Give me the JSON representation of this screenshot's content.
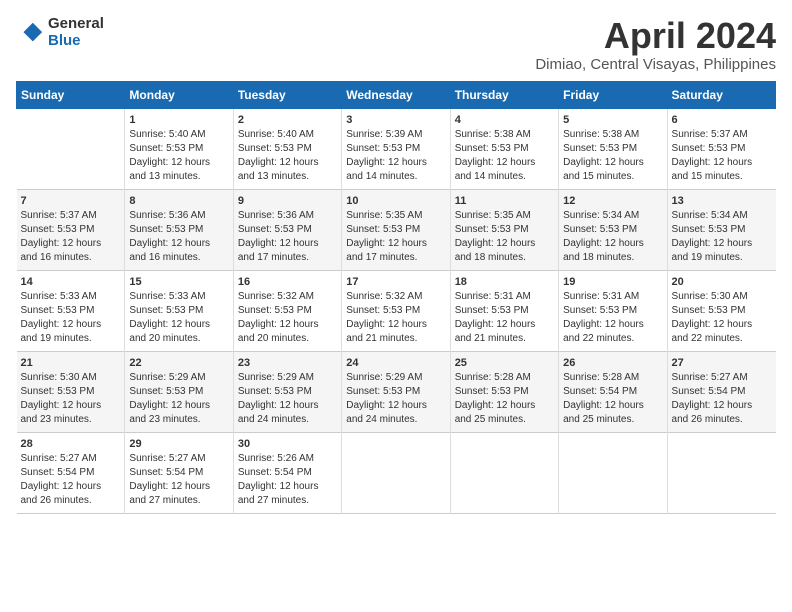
{
  "logo": {
    "general": "General",
    "blue": "Blue"
  },
  "title": "April 2024",
  "subtitle": "Dimiao, Central Visayas, Philippines",
  "days_header": [
    "Sunday",
    "Monday",
    "Tuesday",
    "Wednesday",
    "Thursday",
    "Friday",
    "Saturday"
  ],
  "weeks": [
    [
      {
        "num": "",
        "sunrise": "",
        "sunset": "",
        "daylight": ""
      },
      {
        "num": "1",
        "sunrise": "Sunrise: 5:40 AM",
        "sunset": "Sunset: 5:53 PM",
        "daylight": "Daylight: 12 hours and 13 minutes."
      },
      {
        "num": "2",
        "sunrise": "Sunrise: 5:40 AM",
        "sunset": "Sunset: 5:53 PM",
        "daylight": "Daylight: 12 hours and 13 minutes."
      },
      {
        "num": "3",
        "sunrise": "Sunrise: 5:39 AM",
        "sunset": "Sunset: 5:53 PM",
        "daylight": "Daylight: 12 hours and 14 minutes."
      },
      {
        "num": "4",
        "sunrise": "Sunrise: 5:38 AM",
        "sunset": "Sunset: 5:53 PM",
        "daylight": "Daylight: 12 hours and 14 minutes."
      },
      {
        "num": "5",
        "sunrise": "Sunrise: 5:38 AM",
        "sunset": "Sunset: 5:53 PM",
        "daylight": "Daylight: 12 hours and 15 minutes."
      },
      {
        "num": "6",
        "sunrise": "Sunrise: 5:37 AM",
        "sunset": "Sunset: 5:53 PM",
        "daylight": "Daylight: 12 hours and 15 minutes."
      }
    ],
    [
      {
        "num": "7",
        "sunrise": "Sunrise: 5:37 AM",
        "sunset": "Sunset: 5:53 PM",
        "daylight": "Daylight: 12 hours and 16 minutes."
      },
      {
        "num": "8",
        "sunrise": "Sunrise: 5:36 AM",
        "sunset": "Sunset: 5:53 PM",
        "daylight": "Daylight: 12 hours and 16 minutes."
      },
      {
        "num": "9",
        "sunrise": "Sunrise: 5:36 AM",
        "sunset": "Sunset: 5:53 PM",
        "daylight": "Daylight: 12 hours and 17 minutes."
      },
      {
        "num": "10",
        "sunrise": "Sunrise: 5:35 AM",
        "sunset": "Sunset: 5:53 PM",
        "daylight": "Daylight: 12 hours and 17 minutes."
      },
      {
        "num": "11",
        "sunrise": "Sunrise: 5:35 AM",
        "sunset": "Sunset: 5:53 PM",
        "daylight": "Daylight: 12 hours and 18 minutes."
      },
      {
        "num": "12",
        "sunrise": "Sunrise: 5:34 AM",
        "sunset": "Sunset: 5:53 PM",
        "daylight": "Daylight: 12 hours and 18 minutes."
      },
      {
        "num": "13",
        "sunrise": "Sunrise: 5:34 AM",
        "sunset": "Sunset: 5:53 PM",
        "daylight": "Daylight: 12 hours and 19 minutes."
      }
    ],
    [
      {
        "num": "14",
        "sunrise": "Sunrise: 5:33 AM",
        "sunset": "Sunset: 5:53 PM",
        "daylight": "Daylight: 12 hours and 19 minutes."
      },
      {
        "num": "15",
        "sunrise": "Sunrise: 5:33 AM",
        "sunset": "Sunset: 5:53 PM",
        "daylight": "Daylight: 12 hours and 20 minutes."
      },
      {
        "num": "16",
        "sunrise": "Sunrise: 5:32 AM",
        "sunset": "Sunset: 5:53 PM",
        "daylight": "Daylight: 12 hours and 20 minutes."
      },
      {
        "num": "17",
        "sunrise": "Sunrise: 5:32 AM",
        "sunset": "Sunset: 5:53 PM",
        "daylight": "Daylight: 12 hours and 21 minutes."
      },
      {
        "num": "18",
        "sunrise": "Sunrise: 5:31 AM",
        "sunset": "Sunset: 5:53 PM",
        "daylight": "Daylight: 12 hours and 21 minutes."
      },
      {
        "num": "19",
        "sunrise": "Sunrise: 5:31 AM",
        "sunset": "Sunset: 5:53 PM",
        "daylight": "Daylight: 12 hours and 22 minutes."
      },
      {
        "num": "20",
        "sunrise": "Sunrise: 5:30 AM",
        "sunset": "Sunset: 5:53 PM",
        "daylight": "Daylight: 12 hours and 22 minutes."
      }
    ],
    [
      {
        "num": "21",
        "sunrise": "Sunrise: 5:30 AM",
        "sunset": "Sunset: 5:53 PM",
        "daylight": "Daylight: 12 hours and 23 minutes."
      },
      {
        "num": "22",
        "sunrise": "Sunrise: 5:29 AM",
        "sunset": "Sunset: 5:53 PM",
        "daylight": "Daylight: 12 hours and 23 minutes."
      },
      {
        "num": "23",
        "sunrise": "Sunrise: 5:29 AM",
        "sunset": "Sunset: 5:53 PM",
        "daylight": "Daylight: 12 hours and 24 minutes."
      },
      {
        "num": "24",
        "sunrise": "Sunrise: 5:29 AM",
        "sunset": "Sunset: 5:53 PM",
        "daylight": "Daylight: 12 hours and 24 minutes."
      },
      {
        "num": "25",
        "sunrise": "Sunrise: 5:28 AM",
        "sunset": "Sunset: 5:53 PM",
        "daylight": "Daylight: 12 hours and 25 minutes."
      },
      {
        "num": "26",
        "sunrise": "Sunrise: 5:28 AM",
        "sunset": "Sunset: 5:54 PM",
        "daylight": "Daylight: 12 hours and 25 minutes."
      },
      {
        "num": "27",
        "sunrise": "Sunrise: 5:27 AM",
        "sunset": "Sunset: 5:54 PM",
        "daylight": "Daylight: 12 hours and 26 minutes."
      }
    ],
    [
      {
        "num": "28",
        "sunrise": "Sunrise: 5:27 AM",
        "sunset": "Sunset: 5:54 PM",
        "daylight": "Daylight: 12 hours and 26 minutes."
      },
      {
        "num": "29",
        "sunrise": "Sunrise: 5:27 AM",
        "sunset": "Sunset: 5:54 PM",
        "daylight": "Daylight: 12 hours and 27 minutes."
      },
      {
        "num": "30",
        "sunrise": "Sunrise: 5:26 AM",
        "sunset": "Sunset: 5:54 PM",
        "daylight": "Daylight: 12 hours and 27 minutes."
      },
      {
        "num": "",
        "sunrise": "",
        "sunset": "",
        "daylight": ""
      },
      {
        "num": "",
        "sunrise": "",
        "sunset": "",
        "daylight": ""
      },
      {
        "num": "",
        "sunrise": "",
        "sunset": "",
        "daylight": ""
      },
      {
        "num": "",
        "sunrise": "",
        "sunset": "",
        "daylight": ""
      }
    ]
  ]
}
